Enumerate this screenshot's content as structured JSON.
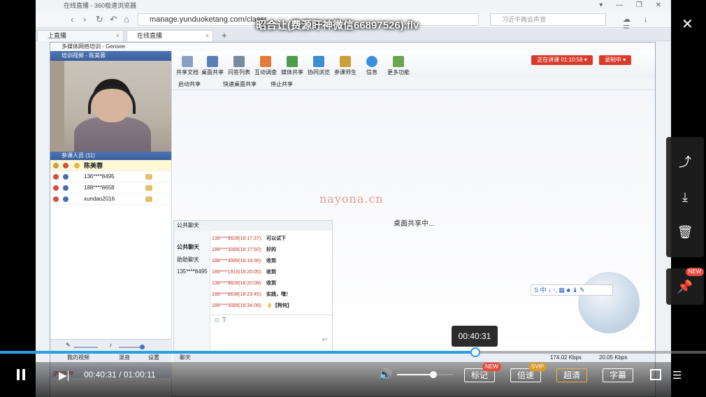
{
  "browser": {
    "title": "在线直播 - 360极速浏览器",
    "url": "manage.yunduoketang.com/classr",
    "search_placeholder": "习近平两会声音",
    "tabs": [
      {
        "label": "上直播"
      },
      {
        "label": "在线直播"
      }
    ]
  },
  "overlay": {
    "file_title": "昭合让(费源盱神微信66897526).flv"
  },
  "gensee": {
    "window_title": "多媒体网络培训 - Gensee",
    "speaker_header": "培训视频 - 陈美蓉",
    "attendee_header": "参课人员 (11)",
    "attendees": [
      {
        "name": "陈美蓉",
        "host": true
      },
      {
        "name": "136****8495"
      },
      {
        "name": "188****8658"
      },
      {
        "name": "xundao2016"
      }
    ],
    "toolbar": [
      {
        "label": "共享文档",
        "icon": "document-icon",
        "color": "#8aa0c0"
      },
      {
        "label": "桌面共享",
        "icon": "desktop-share-icon",
        "color": "#5a7fb8"
      },
      {
        "label": "问答列表",
        "icon": "qa-list-icon",
        "color": "#7a8aa0"
      },
      {
        "label": "互动调查",
        "icon": "survey-icon",
        "color": "#e27b3a"
      },
      {
        "label": "媒体共享",
        "icon": "media-share-icon",
        "color": "#4f9c4f"
      },
      {
        "label": "协同浏览",
        "icon": "co-browse-icon",
        "color": "#3c8dd1"
      },
      {
        "label": "参课师生",
        "icon": "participants-icon",
        "color": "#c9a13a"
      },
      {
        "label": "信息",
        "icon": "info-icon",
        "color": "#3b8ee0"
      },
      {
        "label": "更多功能",
        "icon": "more-icon",
        "color": "#6aa84f"
      }
    ],
    "status_live": "正在讲课 01:10:58 ▾",
    "status_rec": "录制中 ▾",
    "subbar": {
      "start_share": "启动共享",
      "quick_share": "快速桌面共享",
      "stop_share": "停止共享"
    },
    "watermark": "nayona.cn",
    "sharing_text": "桌面共享中...",
    "ime_text": "S 中 ♪ ◦, ▦ ♣ ♝ ✎",
    "chat": {
      "header": "公共聊天",
      "tabs": [
        "公共聊天",
        "助助聊天",
        "135****8495"
      ],
      "messages": [
        {
          "user": "138****9828(18:17:37):",
          "text": "可以试下"
        },
        {
          "user": "188****3089(18:17:50):",
          "text": "好的"
        },
        {
          "user": "188****3089(18:19:36):",
          "text": "收到"
        },
        {
          "user": "189****1915(18:20:05):",
          "text": "收到"
        },
        {
          "user": "138****9828(18:20:08):",
          "text": "收到"
        },
        {
          "user": "188****8638(18:23:45):",
          "text": "实践，嘿！"
        },
        {
          "user": "188****3089(18:34:08):",
          "text": "👌【狗何】"
        }
      ]
    },
    "bottom": {
      "my_video": "我的视频",
      "mix": "混音",
      "settings": "设置",
      "brand": "gensee",
      "chat_tab": "聊天",
      "speed_up": "174.02 Kbps",
      "speed_down": "20.05 Kbps"
    }
  },
  "player": {
    "tooltip": "00:40:31",
    "current": "00:40:31",
    "separator": "/",
    "duration": "01:00:11",
    "progress": 0.673,
    "buffered": 0.66,
    "volume": 0.65,
    "buttons": {
      "mark": "标记",
      "mark_badge": "NEW",
      "speed": "倍速",
      "speed_badge": "SVIP",
      "quality": "超清",
      "subtitle": "字幕"
    },
    "side": {
      "pin_badge": "NEW"
    }
  }
}
